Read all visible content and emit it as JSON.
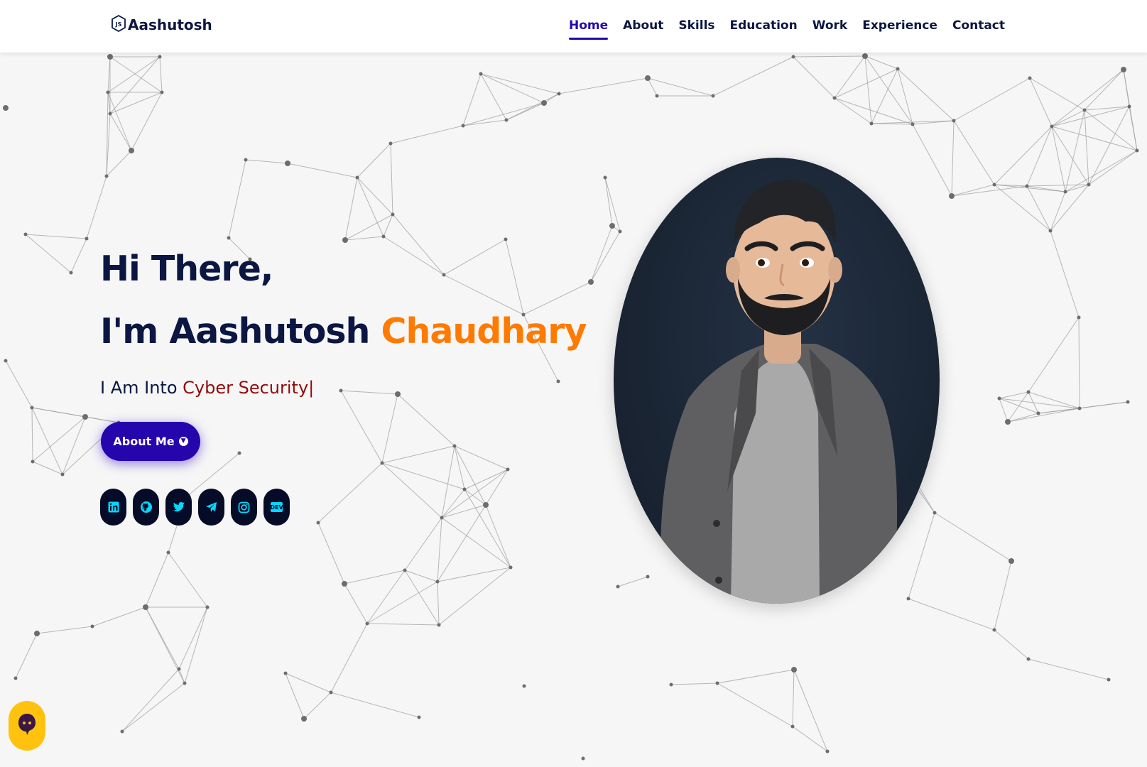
{
  "brand": {
    "name": "Aashutosh",
    "logo_icon": "js-hexagon-icon"
  },
  "nav": {
    "items": [
      {
        "label": "Home",
        "active": true
      },
      {
        "label": "About",
        "active": false
      },
      {
        "label": "Skills",
        "active": false
      },
      {
        "label": "Education",
        "active": false
      },
      {
        "label": "Work",
        "active": false
      },
      {
        "label": "Experience",
        "active": false
      },
      {
        "label": "Contact",
        "active": false
      }
    ]
  },
  "hero": {
    "greeting": "Hi There,",
    "intro_prefix": "I'm Aashutosh",
    "intro_highlight": "Chaudhary",
    "typing_prefix": "I Am Into",
    "typing_text": "Cyber Security",
    "typing_cursor": "|",
    "button_label": "About Me",
    "button_icon": "arrow-circle-down-icon"
  },
  "socials": [
    {
      "name": "linkedin",
      "icon": "linkedin-icon"
    },
    {
      "name": "github",
      "icon": "github-icon"
    },
    {
      "name": "twitter",
      "icon": "twitter-icon"
    },
    {
      "name": "telegram",
      "icon": "telegram-icon"
    },
    {
      "name": "instagram",
      "icon": "instagram-icon"
    },
    {
      "name": "dev",
      "icon": "dev-icon",
      "label": "DEV"
    }
  ],
  "chat_widget": {
    "icon": "chat-bubble-icon"
  },
  "colors": {
    "navy": "#0b1742",
    "accent_blue": "#2506ad",
    "highlight_orange": "#ff7a00",
    "typed_red": "#930b0b",
    "social_bg": "#060b27",
    "social_icon": "#00d9ff",
    "chat_yellow": "#ffc20e",
    "page_bg": "#f6f6f6"
  }
}
